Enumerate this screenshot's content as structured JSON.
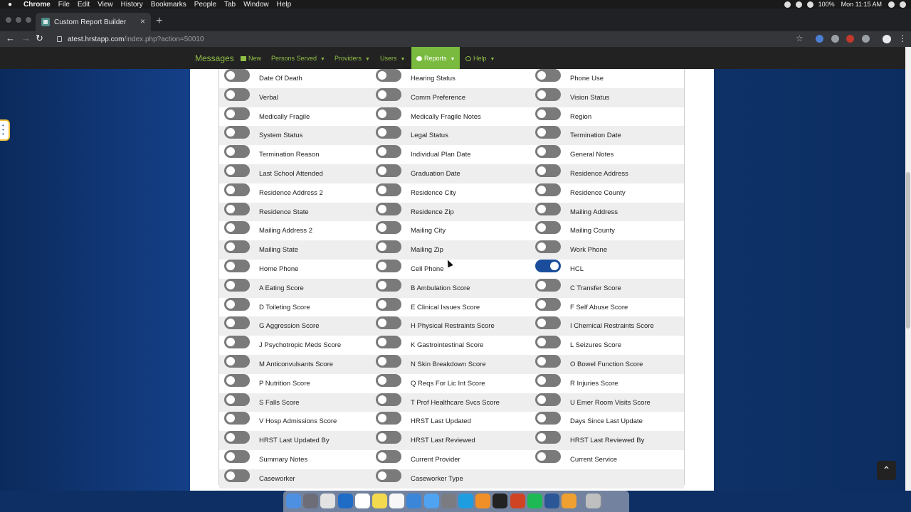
{
  "menubar": {
    "app": "Chrome",
    "items": [
      "File",
      "Edit",
      "View",
      "History",
      "Bookmarks",
      "People",
      "Tab",
      "Window",
      "Help"
    ],
    "battery": "100%",
    "clock": "Mon 11:15 AM"
  },
  "browser": {
    "tab_title": "Custom Report Builder",
    "url_host": "atest.hrstapp.com",
    "url_path": "/index.php?action=50010"
  },
  "site_nav": {
    "brand": "Messages",
    "items": [
      {
        "label": "New",
        "caret": false
      },
      {
        "label": "Persons Served",
        "caret": true
      },
      {
        "label": "Providers",
        "caret": true
      },
      {
        "label": "Users",
        "caret": true
      },
      {
        "label": "Reports",
        "caret": true,
        "active": true
      },
      {
        "label": "Help",
        "caret": true
      }
    ],
    "colors": {
      "bar": "#222222",
      "link": "#8fbf47",
      "active": "#7aba3e"
    }
  },
  "fields": [
    {
      "label": "Date Of Death",
      "on": false
    },
    {
      "label": "Hearing Status",
      "on": false
    },
    {
      "label": "Phone Use",
      "on": false
    },
    {
      "label": "Verbal",
      "on": false
    },
    {
      "label": "Comm Preference",
      "on": false
    },
    {
      "label": "Vision Status",
      "on": false
    },
    {
      "label": "Medically Fragile",
      "on": false
    },
    {
      "label": "Medically Fragile Notes",
      "on": false
    },
    {
      "label": "Region",
      "on": false
    },
    {
      "label": "System Status",
      "on": false
    },
    {
      "label": "Legal Status",
      "on": false
    },
    {
      "label": "Termination Date",
      "on": false
    },
    {
      "label": "Termination Reason",
      "on": false
    },
    {
      "label": "Individual Plan Date",
      "on": false
    },
    {
      "label": "General Notes",
      "on": false
    },
    {
      "label": "Last School Attended",
      "on": false
    },
    {
      "label": "Graduation Date",
      "on": false
    },
    {
      "label": "Residence Address",
      "on": false
    },
    {
      "label": "Residence Address 2",
      "on": false
    },
    {
      "label": "Residence City",
      "on": false
    },
    {
      "label": "Residence County",
      "on": false
    },
    {
      "label": "Residence State",
      "on": false
    },
    {
      "label": "Residence Zip",
      "on": false
    },
    {
      "label": "Mailing Address",
      "on": false
    },
    {
      "label": "Mailing Address 2",
      "on": false
    },
    {
      "label": "Mailing City",
      "on": false
    },
    {
      "label": "Mailing County",
      "on": false
    },
    {
      "label": "Mailing State",
      "on": false
    },
    {
      "label": "Mailing Zip",
      "on": false
    },
    {
      "label": "Work Phone",
      "on": false
    },
    {
      "label": "Home Phone",
      "on": false
    },
    {
      "label": "Cell Phone",
      "on": false
    },
    {
      "label": "HCL",
      "on": true
    },
    {
      "label": "A Eating Score",
      "on": false
    },
    {
      "label": "B Ambulation Score",
      "on": false
    },
    {
      "label": "C Transfer Score",
      "on": false
    },
    {
      "label": "D Toileting Score",
      "on": false
    },
    {
      "label": "E Clinical Issues Score",
      "on": false
    },
    {
      "label": "F Self Abuse Score",
      "on": false
    },
    {
      "label": "G Aggression Score",
      "on": false
    },
    {
      "label": "H Physical Restraints Score",
      "on": false
    },
    {
      "label": "I Chemical Restraints Score",
      "on": false
    },
    {
      "label": "J Psychotropic Meds Score",
      "on": false
    },
    {
      "label": "K Gastrointestinal Score",
      "on": false
    },
    {
      "label": "L Seizures Score",
      "on": false
    },
    {
      "label": "M Anticonvulsants Score",
      "on": false
    },
    {
      "label": "N Skin Breakdown Score",
      "on": false
    },
    {
      "label": "O Bowel Function Score",
      "on": false
    },
    {
      "label": "P Nutrition Score",
      "on": false
    },
    {
      "label": "Q Reqs For Lic Int Score",
      "on": false
    },
    {
      "label": "R Injuries Score",
      "on": false
    },
    {
      "label": "S Falls Score",
      "on": false
    },
    {
      "label": "T Prof Healthcare Svcs Score",
      "on": false
    },
    {
      "label": "U Emer Room Visits Score",
      "on": false
    },
    {
      "label": "V Hosp Admissions Score",
      "on": false
    },
    {
      "label": "HRST Last Updated",
      "on": false
    },
    {
      "label": "Days Since Last Update",
      "on": false
    },
    {
      "label": "HRST Last Updated By",
      "on": false
    },
    {
      "label": "HRST Last Reviewed",
      "on": false
    },
    {
      "label": "HRST Last Reviewed By",
      "on": false
    },
    {
      "label": "Summary Notes",
      "on": false
    },
    {
      "label": "Current Provider",
      "on": false
    },
    {
      "label": "Current Service",
      "on": false
    },
    {
      "label": "Caseworker",
      "on": false
    },
    {
      "label": "Caseworker Type",
      "on": false
    }
  ],
  "toggle_colors": {
    "off": "#7a7a7a",
    "on": "#1a4d9c"
  },
  "scroll_to_top_icon": "chevron-up-icon",
  "dock_apps": [
    "finder-icon",
    "launchpad-icon",
    "chrome-icon",
    "outlook-icon",
    "calendar-icon",
    "notes-icon",
    "reminders-icon",
    "safari-icon",
    "messages-icon",
    "system-preferences-icon",
    "skype-icon",
    "sublime-icon",
    "terminal-icon",
    "powerpoint-icon",
    "spotify-icon",
    "word-icon",
    "snowflake-icon",
    "trash-icon"
  ]
}
